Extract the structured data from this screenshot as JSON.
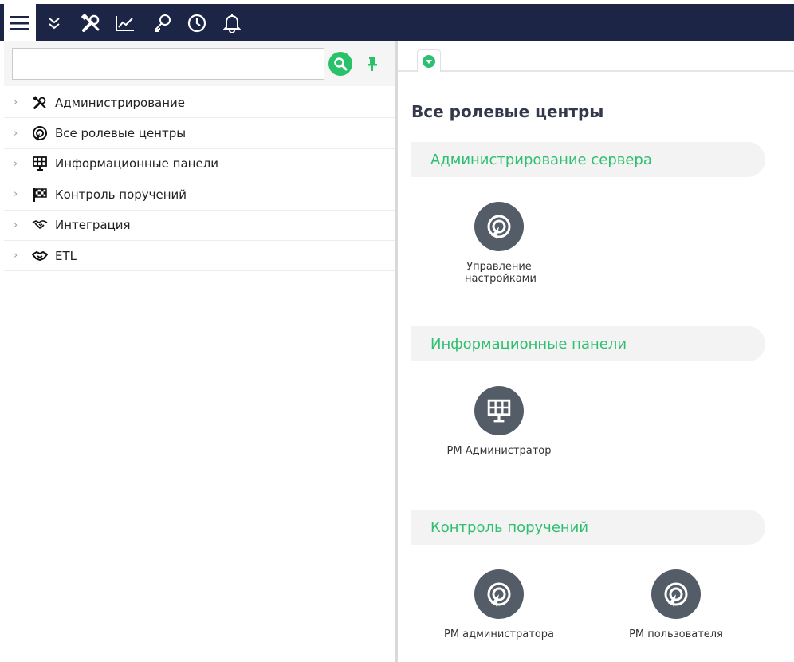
{
  "toolbar": {
    "buttons": [
      {
        "icon": "hamburger-menu-icon"
      },
      {
        "icon": "double-chevron-down-icon"
      },
      {
        "icon": "tools-icon"
      },
      {
        "icon": "line-chart-icon"
      },
      {
        "icon": "key-icon"
      },
      {
        "icon": "clock-icon"
      },
      {
        "icon": "bell-icon"
      }
    ]
  },
  "search": {
    "value": "",
    "placeholder": ""
  },
  "tree": {
    "items": [
      {
        "label": "Администрирование",
        "icon": "tools-icon"
      },
      {
        "label": "Все ролевые центры",
        "icon": "target-cursor-icon"
      },
      {
        "label": "Информационные панели",
        "icon": "solar-panel-icon"
      },
      {
        "label": "Контроль поручений",
        "icon": "checkered-flag-icon"
      },
      {
        "label": "Интеграция",
        "icon": "handshake-icon"
      },
      {
        "label": "ETL",
        "icon": "handshake-icon"
      }
    ]
  },
  "main": {
    "title": "Все ролевые центры",
    "sections": [
      {
        "title": "Администрирование сервера",
        "tiles": [
          {
            "label": "Управление настройками",
            "icon": "target-cursor-icon"
          }
        ]
      },
      {
        "title": "Информационные панели",
        "tiles": [
          {
            "label": "РМ Администратор",
            "icon": "solar-panel-icon"
          }
        ]
      },
      {
        "title": "Контроль поручений",
        "tiles": [
          {
            "label": "РМ администратора",
            "icon": "target-cursor-icon"
          },
          {
            "label": "РМ пользователя",
            "icon": "target-cursor-icon"
          }
        ]
      }
    ]
  },
  "colors": {
    "toolbar_bg": "#1c2546",
    "accent_green": "#2fbf71",
    "tile_circle": "#535c67"
  }
}
